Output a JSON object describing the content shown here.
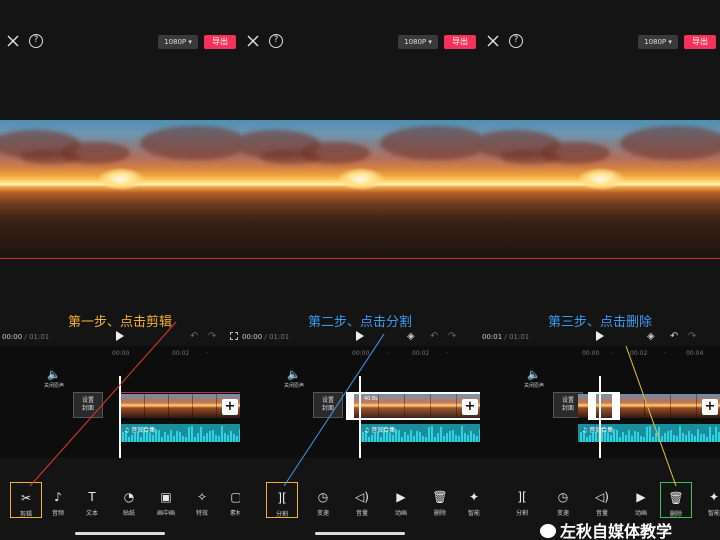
{
  "header": {
    "resolution": "1080P ▾",
    "export_label": "导出",
    "help": "?"
  },
  "panels": [
    {
      "step": "第一步、点击剪辑",
      "time_current": "00:00",
      "time_total": " / 01:01",
      "ruler": [
        "00:00",
        "·",
        "00:02",
        "·"
      ],
      "mute_label": "关闭原声",
      "cover_label": "设置\n封面",
      "audio_label": "♫ 音效合集",
      "tools": [
        {
          "icon": "✂",
          "label": "剪辑"
        },
        {
          "icon": "♪",
          "label": "音频"
        },
        {
          "icon": "T",
          "label": "文本"
        },
        {
          "icon": "◔",
          "label": "贴纸"
        },
        {
          "icon": "▣",
          "label": "画中画"
        },
        {
          "icon": "✧",
          "label": "特效"
        },
        {
          "icon": "▢",
          "label": "素材"
        }
      ]
    },
    {
      "step": "第二步、点击分割",
      "time_current": "00:00",
      "time_total": " / 01:01",
      "ruler": [
        "00:00",
        "·",
        "00:02",
        "·"
      ],
      "mute_label": "关闭原声",
      "cover_label": "设置\n封面",
      "audio_label": "♫ 音效合集",
      "clip_duration": "40.8s",
      "tools": [
        {
          "icon": "][",
          "label": "分割"
        },
        {
          "icon": "◷",
          "label": "变速"
        },
        {
          "icon": "◁)",
          "label": "音量"
        },
        {
          "icon": "▶",
          "label": "动画"
        },
        {
          "icon": "🗑",
          "label": "删除"
        },
        {
          "icon": "✦",
          "label": "智能"
        }
      ]
    },
    {
      "step": "第三步、点击删除",
      "time_current": "00:01",
      "time_total": " / 01:01",
      "ruler": [
        "00:00",
        "·",
        "00:02",
        "·",
        "00:04"
      ],
      "mute_label": "关闭原声",
      "cover_label": "设置\n封面",
      "audio_label": "♫ 音效合集",
      "tools": [
        {
          "icon": "][",
          "label": "分割"
        },
        {
          "icon": "◷",
          "label": "变速"
        },
        {
          "icon": "◁)",
          "label": "音量"
        },
        {
          "icon": "▶",
          "label": "动画"
        },
        {
          "icon": "🗑",
          "label": "删除"
        },
        {
          "icon": "✦",
          "label": "智能"
        }
      ]
    }
  ],
  "watermark": "左秋自媒体教学",
  "colors": {
    "export": "#f5325c",
    "step1": "#f3b12e",
    "step_blue": "#3b9bf0",
    "audio": "#1a8e9c"
  }
}
